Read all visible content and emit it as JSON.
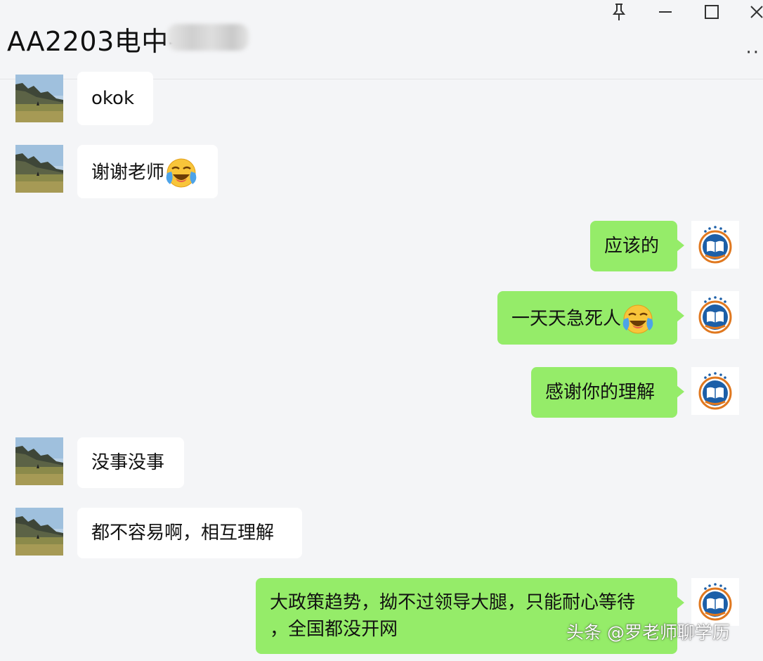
{
  "window": {
    "title": "AA2203电中-",
    "controls": {
      "pin": "⚲",
      "minimize": "—",
      "maximize": "☐",
      "close": "✕"
    },
    "more": "··"
  },
  "messages": [
    {
      "side": "left",
      "text": "okok"
    },
    {
      "side": "left",
      "text": "谢谢老师",
      "emoji": "crying-laughing-emoji"
    },
    {
      "side": "right",
      "text": "应该的"
    },
    {
      "side": "right",
      "text": "一天天急死人",
      "emoji": "crying-laughing-emoji"
    },
    {
      "side": "right",
      "text": "感谢你的理解"
    },
    {
      "side": "left",
      "text": "没事没事"
    },
    {
      "side": "left",
      "text": "都不容易啊，相互理解"
    },
    {
      "side": "right",
      "text_line1": "大政策趋势，拗不过领导大腿，只能耐心等待",
      "text_line2": "，全国都没开网"
    }
  ],
  "watermark": "头条 @罗老师聊学历",
  "colors": {
    "out_bubble": "#95ec69",
    "in_bubble": "#ffffff",
    "background": "#f4f5f7"
  }
}
